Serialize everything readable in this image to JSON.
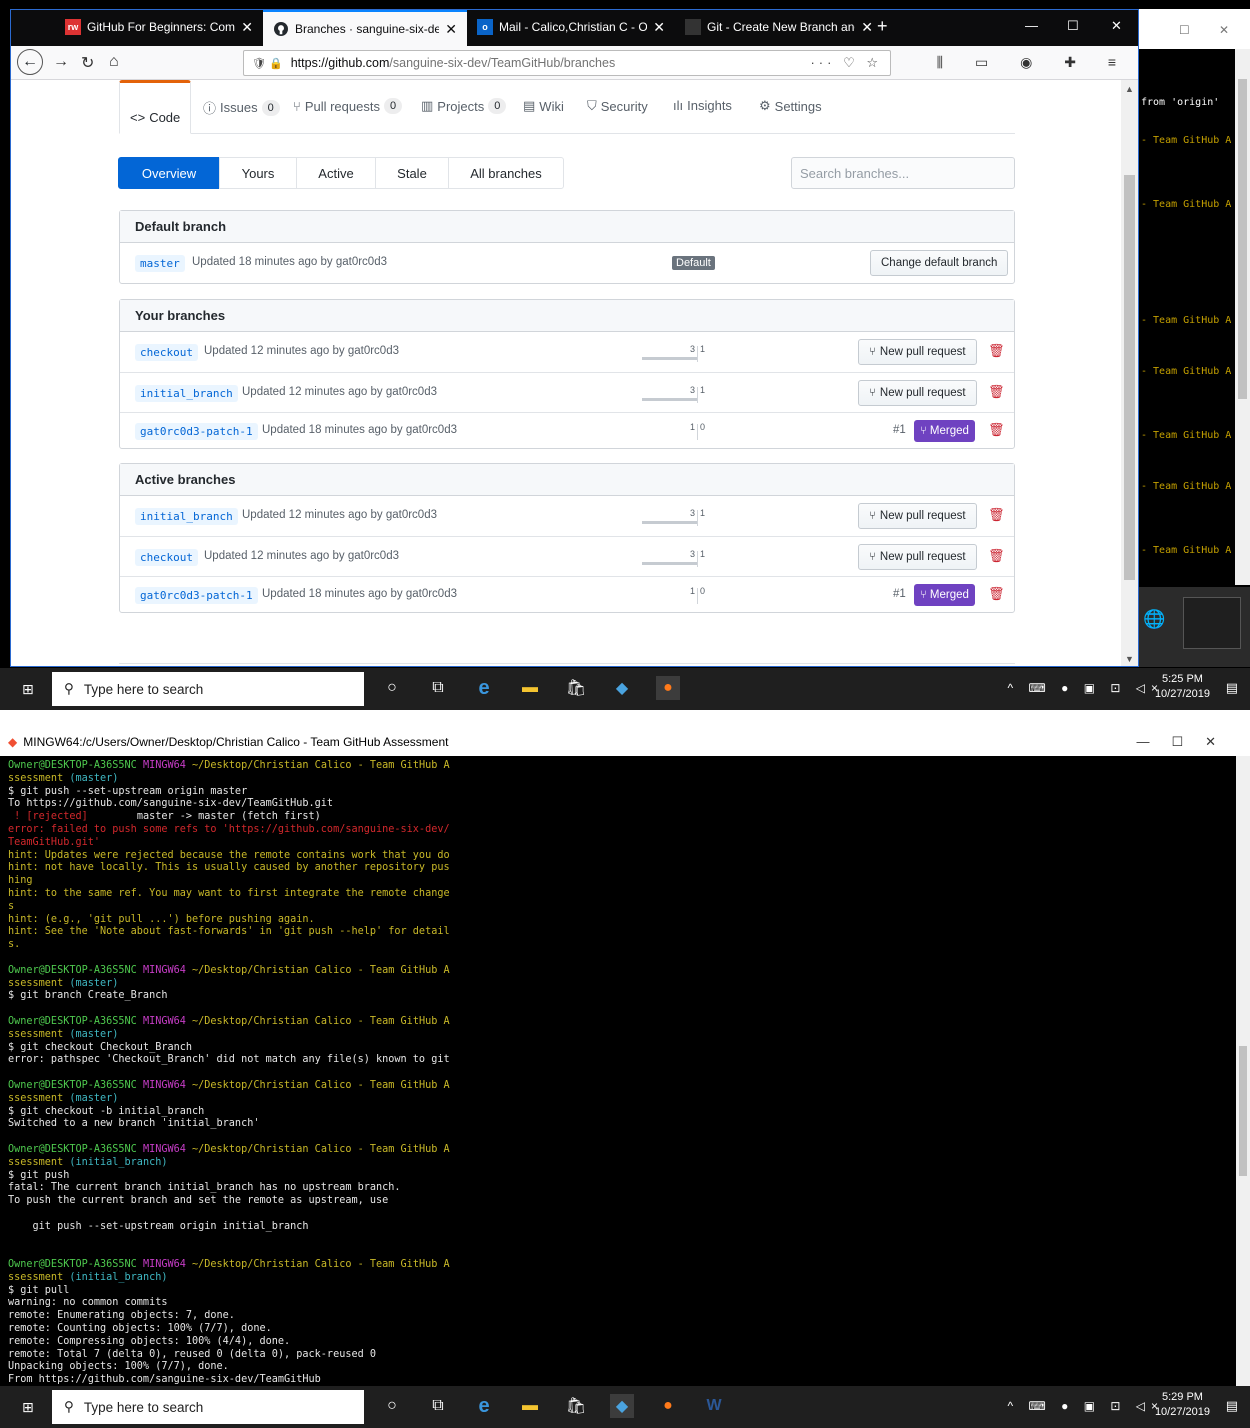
{
  "browser": {
    "tabs": [
      {
        "title": "GitHub For Beginners: Commit",
        "favicon": "rw-icon",
        "active": false
      },
      {
        "title": "Branches · sanguine-six-dev/Te",
        "favicon": "github-icon",
        "active": true
      },
      {
        "title": "Mail - Calico,Christian C - Outl",
        "favicon": "outlook-icon",
        "active": false
      },
      {
        "title": "Git - Create New Branch and C",
        "favicon": "page-icon",
        "active": false
      }
    ],
    "url_host": "https://github.com",
    "url_path": "/sanguine-six-dev/TeamGitHub/branches"
  },
  "repo_nav": {
    "code": "Code",
    "issues": "Issues",
    "issues_count": "0",
    "pulls": "Pull requests",
    "pulls_count": "0",
    "projects": "Projects",
    "projects_count": "0",
    "wiki": "Wiki",
    "security": "Security",
    "insights": "Insights",
    "settings": "Settings"
  },
  "subnav": {
    "overview": "Overview",
    "yours": "Yours",
    "active": "Active",
    "stale": "Stale",
    "all": "All branches",
    "search_placeholder": "Search branches..."
  },
  "default_section": {
    "title": "Default branch",
    "branch": "master",
    "meta": "Updated 18 minutes ago by gat0rc0d3",
    "badge": "Default",
    "button": "Change default branch"
  },
  "your_section": {
    "title": "Your branches",
    "rows": [
      {
        "name": "checkout",
        "meta": "Updated 12 minutes ago by gat0rc0d3",
        "behind": "3",
        "ahead": "1",
        "action": "New pull request"
      },
      {
        "name": "initial_branch",
        "meta": "Updated 12 minutes ago by gat0rc0d3",
        "behind": "3",
        "ahead": "1",
        "action": "New pull request"
      },
      {
        "name": "gat0rc0d3-patch-1",
        "meta": "Updated 18 minutes ago by gat0rc0d3",
        "behind": "1",
        "ahead": "0",
        "pr": "#1",
        "status": "Merged"
      }
    ]
  },
  "active_section": {
    "title": "Active branches",
    "rows": [
      {
        "name": "initial_branch",
        "meta": "Updated 12 minutes ago by gat0rc0d3",
        "behind": "3",
        "ahead": "1",
        "action": "New pull request"
      },
      {
        "name": "checkout",
        "meta": "Updated 12 minutes ago by gat0rc0d3",
        "behind": "3",
        "ahead": "1",
        "action": "New pull request"
      },
      {
        "name": "gat0rc0d3-patch-1",
        "meta": "Updated 18 minutes ago by gat0rc0d3",
        "behind": "1",
        "ahead": "0",
        "pr": "#1",
        "status": "Merged"
      }
    ]
  },
  "strip_lines": [
    " from 'origin'",
    "- Team GitHub A",
    "- Team GitHub A",
    "- Team GitHub A",
    "- Team GitHub A",
    "- Team GitHub A",
    "- Team GitHub A",
    "- Team GitHub A"
  ],
  "taskbar1": {
    "search": "Type here to search",
    "time": "5:25 PM",
    "date": "10/27/2019"
  },
  "taskbar2": {
    "search": "Type here to search",
    "time": "5:29 PM",
    "date": "10/27/2019"
  },
  "terminal": {
    "title": "MINGW64:/c/Users/Owner/Desktop/Christian Calico - Team GitHub Assessment",
    "lines": [
      [
        [
          "green",
          "Owner@DESKTOP-A36S5NC "
        ],
        [
          "magenta",
          "MINGW64 "
        ],
        [
          "yellow",
          "~/Desktop/Christian Calico - Team GitHub A"
        ]
      ],
      [
        [
          "yellow",
          "ssessment "
        ],
        [
          "cyan",
          "(master)"
        ]
      ],
      [
        [
          "white",
          "$ git push --set-upstream origin master"
        ]
      ],
      [
        [
          "white",
          "To https://github.com/sanguine-six-dev/TeamGitHub.git"
        ]
      ],
      [
        [
          "red",
          " ! [rejected]        "
        ],
        [
          "white",
          "master -> master (fetch first)"
        ]
      ],
      [
        [
          "red",
          "error: failed to push some refs to 'https://github.com/sanguine-six-dev/"
        ]
      ],
      [
        [
          "red",
          "TeamGitHub.git'"
        ]
      ],
      [
        [
          "yellow",
          "hint: Updates were rejected because the remote contains work that you do"
        ]
      ],
      [
        [
          "yellow",
          "hint: not have locally. This is usually caused by another repository pus"
        ]
      ],
      [
        [
          "yellow",
          "hing"
        ]
      ],
      [
        [
          "yellow",
          "hint: to the same ref. You may want to first integrate the remote change"
        ]
      ],
      [
        [
          "yellow",
          "s"
        ]
      ],
      [
        [
          "yellow",
          "hint: (e.g., 'git pull ...') before pushing again."
        ]
      ],
      [
        [
          "yellow",
          "hint: See the 'Note about fast-forwards' in 'git push --help' for detail"
        ]
      ],
      [
        [
          "yellow",
          "s."
        ]
      ],
      [
        [
          "white",
          ""
        ]
      ],
      [
        [
          "green",
          "Owner@DESKTOP-A36S5NC "
        ],
        [
          "magenta",
          "MINGW64 "
        ],
        [
          "yellow",
          "~/Desktop/Christian Calico - Team GitHub A"
        ]
      ],
      [
        [
          "yellow",
          "ssessment "
        ],
        [
          "cyan",
          "(master)"
        ]
      ],
      [
        [
          "white",
          "$ git branch Create_Branch"
        ]
      ],
      [
        [
          "white",
          ""
        ]
      ],
      [
        [
          "green",
          "Owner@DESKTOP-A36S5NC "
        ],
        [
          "magenta",
          "MINGW64 "
        ],
        [
          "yellow",
          "~/Desktop/Christian Calico - Team GitHub A"
        ]
      ],
      [
        [
          "yellow",
          "ssessment "
        ],
        [
          "cyan",
          "(master)"
        ]
      ],
      [
        [
          "white",
          "$ git checkout Checkout_Branch"
        ]
      ],
      [
        [
          "white",
          "error: pathspec 'Checkout_Branch' did not match any file(s) known to git"
        ]
      ],
      [
        [
          "white",
          ""
        ]
      ],
      [
        [
          "green",
          "Owner@DESKTOP-A36S5NC "
        ],
        [
          "magenta",
          "MINGW64 "
        ],
        [
          "yellow",
          "~/Desktop/Christian Calico - Team GitHub A"
        ]
      ],
      [
        [
          "yellow",
          "ssessment "
        ],
        [
          "cyan",
          "(master)"
        ]
      ],
      [
        [
          "white",
          "$ git checkout -b initial_branch"
        ]
      ],
      [
        [
          "white",
          "Switched to a new branch 'initial_branch'"
        ]
      ],
      [
        [
          "white",
          ""
        ]
      ],
      [
        [
          "green",
          "Owner@DESKTOP-A36S5NC "
        ],
        [
          "magenta",
          "MINGW64 "
        ],
        [
          "yellow",
          "~/Desktop/Christian Calico - Team GitHub A"
        ]
      ],
      [
        [
          "yellow",
          "ssessment "
        ],
        [
          "cyan",
          "(initial_branch)"
        ]
      ],
      [
        [
          "white",
          "$ git push"
        ]
      ],
      [
        [
          "white",
          "fatal: The current branch initial_branch has no upstream branch."
        ]
      ],
      [
        [
          "white",
          "To push the current branch and set the remote as upstream, use"
        ]
      ],
      [
        [
          "white",
          ""
        ]
      ],
      [
        [
          "white",
          "    git push --set-upstream origin initial_branch"
        ]
      ],
      [
        [
          "white",
          ""
        ]
      ],
      [
        [
          "white",
          ""
        ]
      ],
      [
        [
          "green",
          "Owner@DESKTOP-A36S5NC "
        ],
        [
          "magenta",
          "MINGW64 "
        ],
        [
          "yellow",
          "~/Desktop/Christian Calico - Team GitHub A"
        ]
      ],
      [
        [
          "yellow",
          "ssessment "
        ],
        [
          "cyan",
          "(initial_branch)"
        ]
      ],
      [
        [
          "white",
          "$ git pull"
        ]
      ],
      [
        [
          "white",
          "warning: no common commits"
        ]
      ],
      [
        [
          "white",
          "remote: Enumerating objects: 7, done."
        ]
      ],
      [
        [
          "white",
          "remote: Counting objects: 100% (7/7), done."
        ]
      ],
      [
        [
          "white",
          "remote: Compressing objects: 100% (4/4), done."
        ]
      ],
      [
        [
          "white",
          "remote: Total 7 (delta 0), reused 0 (delta 0), pack-reused 0"
        ]
      ],
      [
        [
          "white",
          "Unpacking objects: 100% (7/7), done."
        ]
      ],
      [
        [
          "white",
          "From https://github.com/sanguine-six-dev/TeamGitHub"
        ]
      ]
    ]
  }
}
